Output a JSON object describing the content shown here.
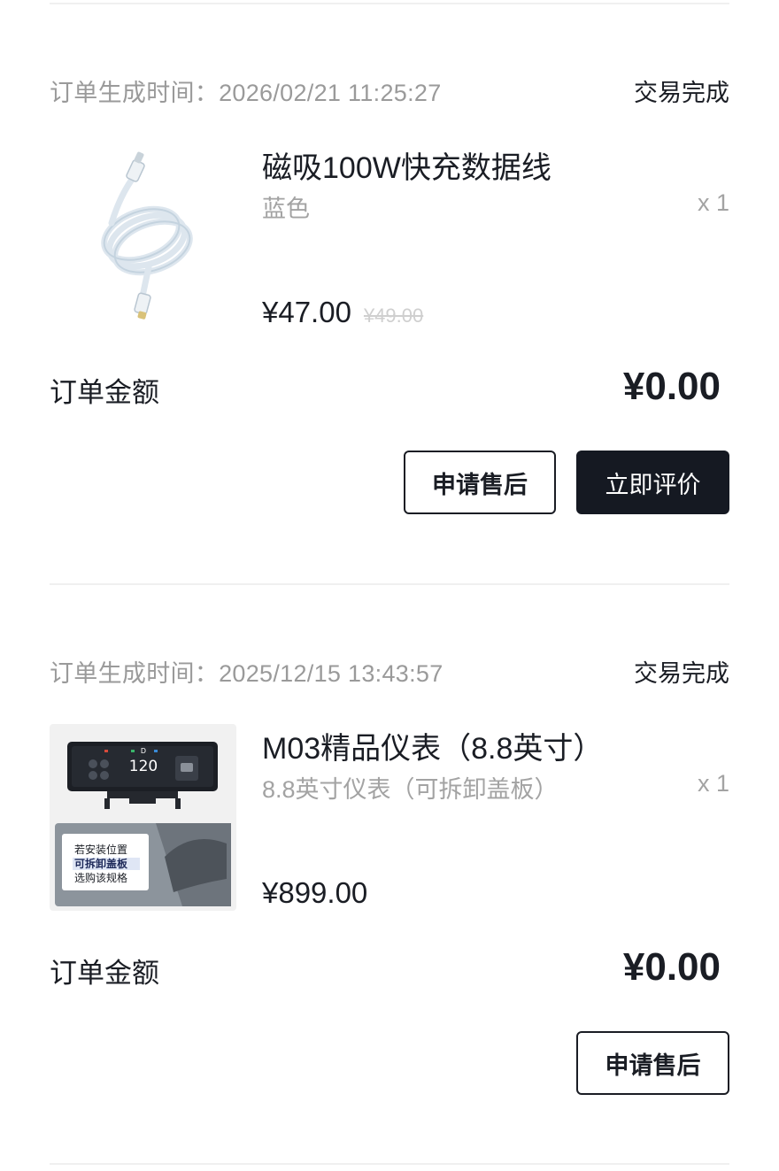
{
  "orders": [
    {
      "time_label": "订单生成时间：2026/02/21 11:25:27",
      "status": "交易完成",
      "product": {
        "icon": "usb-c-cable-image",
        "title": "磁吸100W快充数据线",
        "spec": "蓝色",
        "qty": "x 1",
        "price": "¥47.00",
        "orig_price": "¥49.00"
      },
      "amount_label": "订单金额",
      "amount_value": "¥0.00",
      "buttons": {
        "after_sale": "申请售后",
        "review": "立即评价"
      }
    },
    {
      "time_label": "订单生成时间：2025/12/15 13:43:57",
      "status": "交易完成",
      "product": {
        "icon": "dashboard-display-image",
        "title": "M03精品仪表（8.8英寸）",
        "spec": "8.8英寸仪表（可拆卸盖板）",
        "qty": "x 1",
        "price": "¥899.00",
        "image_text": {
          "speed": "120",
          "gear": "D",
          "note_line1": "若安装位置",
          "note_line2": "可拆卸盖板",
          "note_line3": "选购该规格"
        }
      },
      "amount_label": "订单金额",
      "amount_value": "¥0.00",
      "buttons": {
        "after_sale": "申请售后"
      }
    }
  ]
}
